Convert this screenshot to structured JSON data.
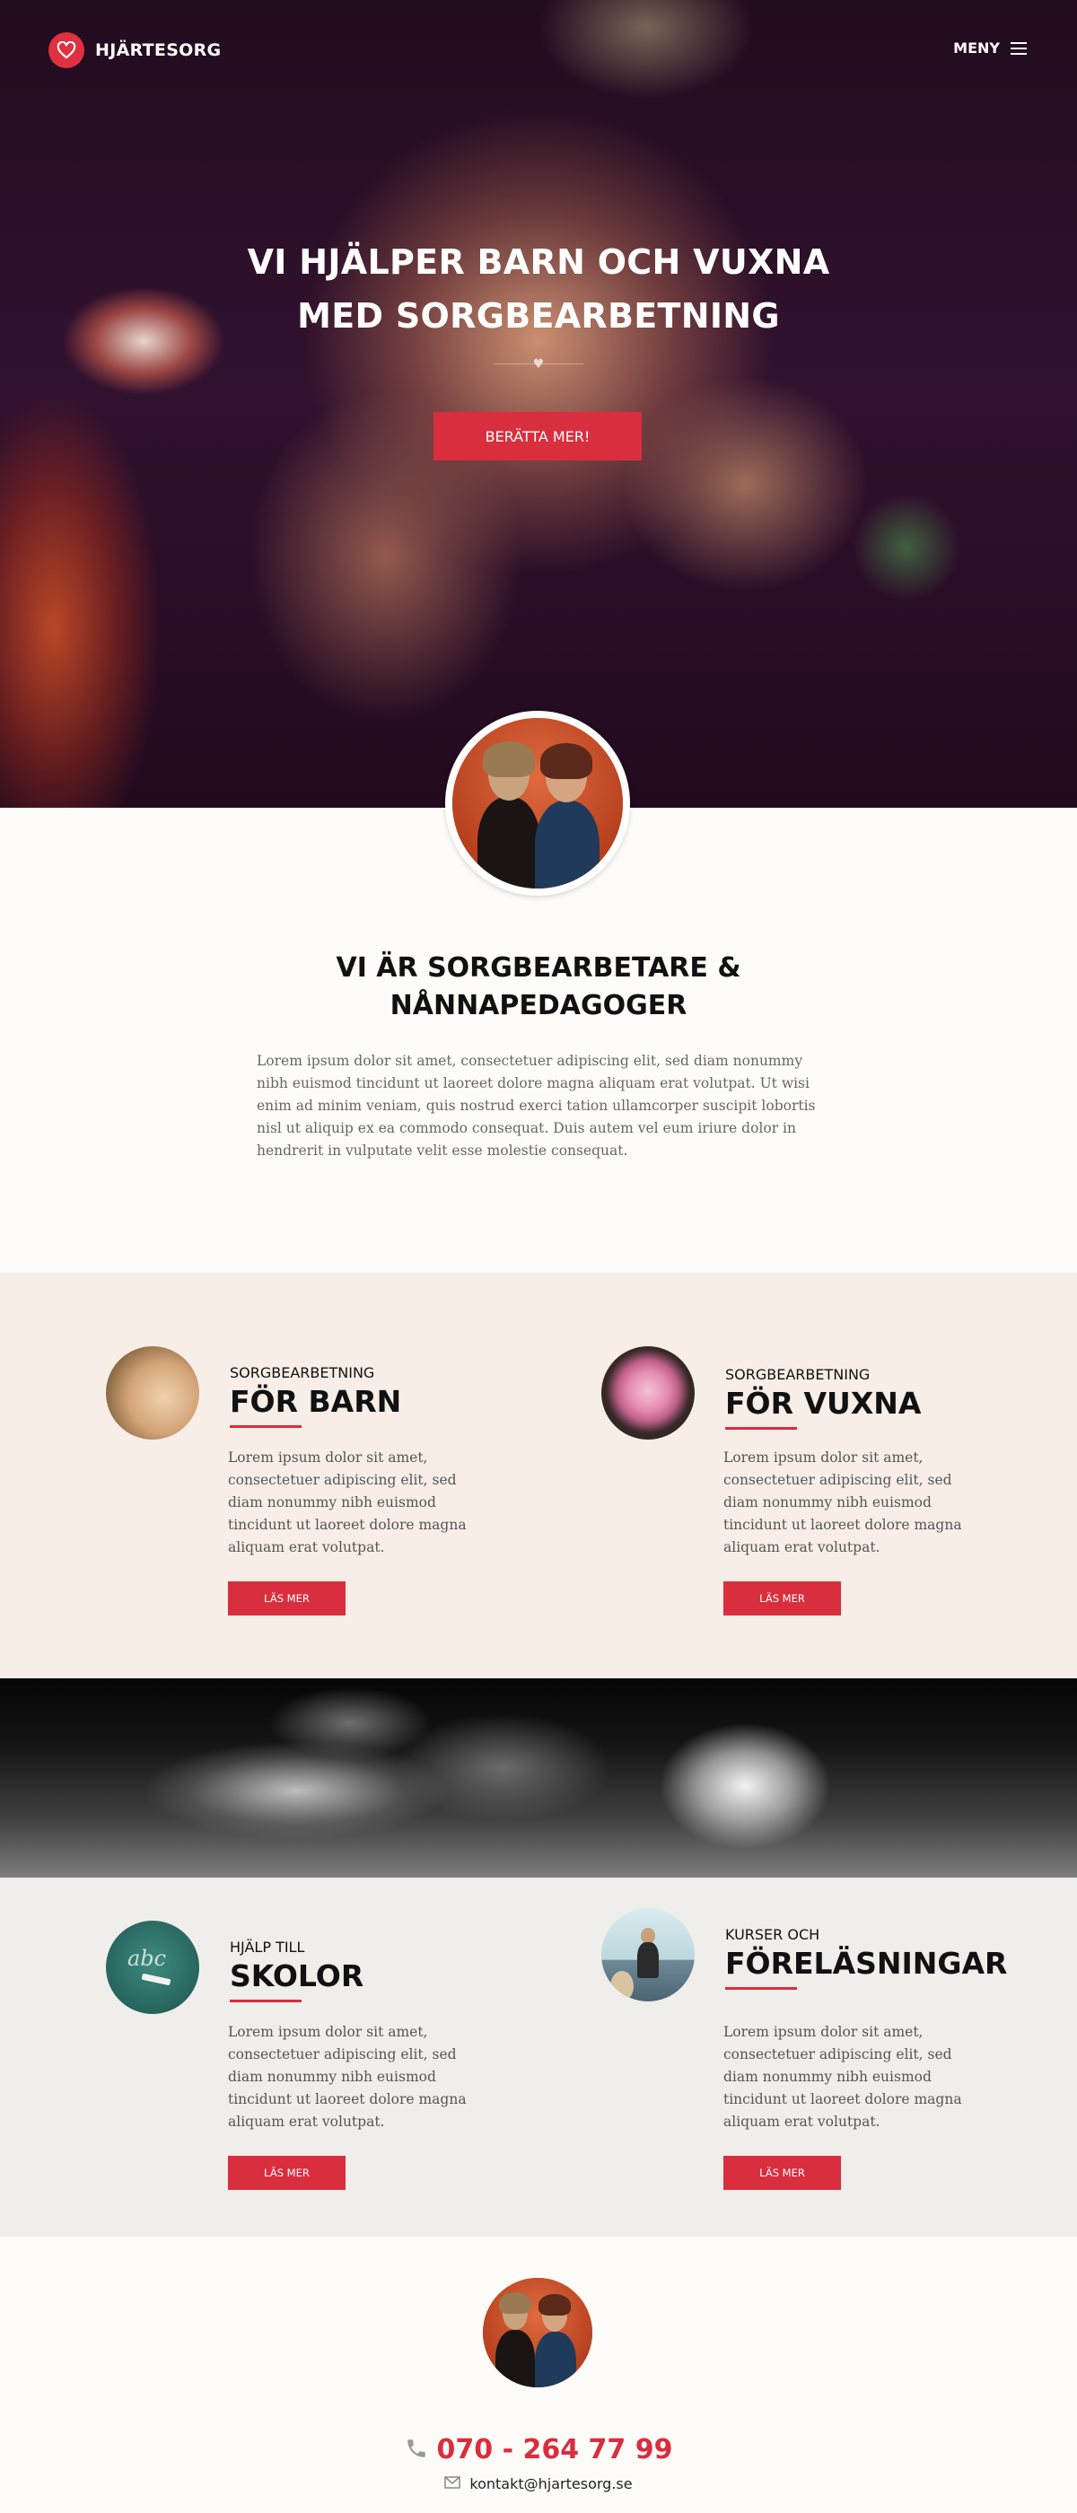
{
  "header": {
    "brand": "HJÄRTESORG",
    "menu_label": "MENY"
  },
  "hero": {
    "title_line1": "VI HJÄLPER BARN OCH VUXNA",
    "title_line2": "MED SORGBEARBETNING",
    "cta_label": "BERÄTTA MER!"
  },
  "intro": {
    "title_line1": "VI ÄR SORGBEARBETARE &",
    "title_line2": "NÅNNAPEDAGOGER",
    "text": "Lorem ipsum dolor sit amet, consectetuer adipiscing elit, sed diam nonummy nibh euismod tincidunt ut laoreet dolore magna aliquam erat volutpat. Ut wisi enim ad minim veniam, quis nostrud exerci tation ullamcorper suscipit lobortis nisl ut aliquip ex ea commodo consequat. Duis autem vel eum iriure dolor in hendrerit in vulputate velit esse molestie consequat."
  },
  "services": [
    {
      "kicker": "SORGBEARBETNING",
      "title": "FÖR BARN",
      "text": "Lorem ipsum dolor sit amet, consectetuer adipiscing elit, sed diam nonummy nibh euismod tincidunt ut laoreet dolore magna aliquam erat volutpat.",
      "button": "LÄS MER",
      "icon": "child-photo"
    },
    {
      "kicker": "SORGBEARBETNING",
      "title": "FÖR VUXNA",
      "text": "Lorem ipsum dolor sit amet, consectetuer adipiscing elit, sed diam nonummy nibh euismod tincidunt ut laoreet dolore magna aliquam erat volutpat.",
      "button": "LÄS MER",
      "icon": "rose-photo"
    },
    {
      "kicker": "HJÄLP TILL",
      "title": "SKOLOR",
      "text": "Lorem ipsum dolor sit amet, consectetuer adipiscing elit, sed diam nonummy nibh euismod tincidunt ut laoreet dolore magna aliquam erat volutpat.",
      "button": "LÄS MER",
      "icon": "chalkboard-photo",
      "chalk_text": "abc"
    },
    {
      "kicker": "KURSER OCH",
      "title": "FÖRELÄSNINGAR",
      "text": "Lorem ipsum dolor sit amet, consectetuer adipiscing elit, sed diam nonummy nibh euismod tincidunt ut laoreet dolore magna aliquam erat volutpat.",
      "button": "LÄS MER",
      "icon": "lecture-photo"
    }
  ],
  "contact": {
    "phone": "070 - 264 77 99",
    "email": "kontakt@hjartesorg.se"
  },
  "colors": {
    "accent": "#d92e3e",
    "cream": "#fdfcf8",
    "beige_band": "#f7eee7",
    "grey_band": "#f0eeeb"
  }
}
